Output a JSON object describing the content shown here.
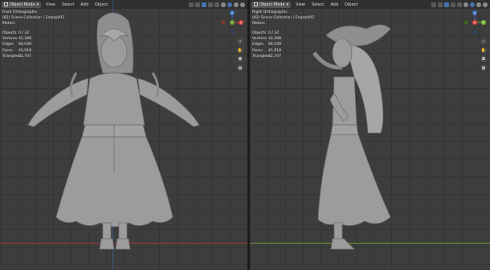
{
  "left_viewport": {
    "mode": "Object Mode",
    "menu": [
      "View",
      "Select",
      "Add",
      "Object"
    ],
    "view_name": "Front Orthographic",
    "collection": "(82) Scene Collection | Empty003",
    "units": "Meters",
    "stats": [
      {
        "label": "Objects",
        "value": "0 / 32"
      },
      {
        "label": "Vertices",
        "value": "42,308"
      },
      {
        "label": "Edges",
        "value": "84,049"
      },
      {
        "label": "Faces",
        "value": "41,918"
      },
      {
        "label": "Triangles",
        "value": "82,707"
      }
    ]
  },
  "right_viewport": {
    "mode": "Object Mode",
    "menu": [
      "View",
      "Select",
      "Add",
      "Object"
    ],
    "view_name": "Right Orthographic",
    "collection": "(82) Scene Collection | Empty002",
    "units": "Meters",
    "stats": [
      {
        "label": "Objects",
        "value": "0 / 32"
      },
      {
        "label": "Vertices",
        "value": "42,308"
      },
      {
        "label": "Edges",
        "value": "84,049"
      },
      {
        "label": "Faces",
        "value": "41,918"
      },
      {
        "label": "Triangles",
        "value": "82,707"
      }
    ]
  },
  "gizmo_labels": {
    "z": "Z",
    "y": "Y",
    "x": "X"
  },
  "nav_icons": [
    "zoom-icon",
    "hand-pan-icon",
    "camera-icon",
    "grid-icon"
  ],
  "colors": {
    "viewport_bg": "#3d3d3d",
    "header_bg": "#303030",
    "x_axis": "#a23838",
    "y_axis": "#6a9a2e",
    "z_axis": "#3a5fa0",
    "model": "#9a9a9a"
  }
}
